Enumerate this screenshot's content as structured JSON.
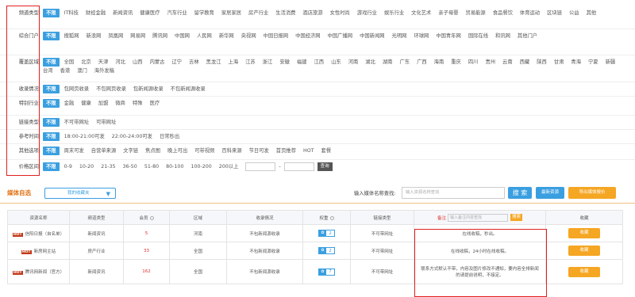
{
  "filters": [
    {
      "label": "频道类型:",
      "unlimited": "不限",
      "options": [
        "IT科技",
        "财经金融",
        "新闻资讯",
        "健康医疗",
        "汽车行业",
        "留学教育",
        "家居家居",
        "房产行业",
        "生活消费",
        "酒店旅游",
        "女性时尚",
        "游戏行业",
        "娱乐行业",
        "文化艺术",
        "亲子母婴",
        "贸易能源",
        "食品餐饮",
        "体育运动",
        "区块链",
        "公益",
        "其他"
      ]
    },
    {
      "label": "综合门户:",
      "unlimited": "不限",
      "options": [
        "搜狐网",
        "新浪网",
        "凤凰网",
        "网易网",
        "腾讯网",
        "中国网",
        "人民网",
        "新华网",
        "央视网",
        "中国日报网",
        "中国经济网",
        "中国广播网",
        "中国新闻网",
        "光明网",
        "环球网",
        "中国青年网",
        "国际在线",
        "和讯网",
        "其他门户"
      ]
    },
    {
      "label": "覆盖区域:",
      "unlimited": "不限",
      "options": [
        "全国",
        "北京",
        "天津",
        "河北",
        "山西",
        "内蒙古",
        "辽宁",
        "吉林",
        "黑龙江",
        "上海",
        "江苏",
        "浙江",
        "安徽",
        "福建",
        "江西",
        "山东",
        "河南",
        "湖北",
        "湖南",
        "广东",
        "广西",
        "海南",
        "重庆",
        "四川",
        "贵州",
        "云南",
        "西藏",
        "陕西",
        "甘肃",
        "青海",
        "宁夏",
        "新疆",
        "台湾",
        "香港",
        "澳门",
        "海外发稿"
      ]
    },
    {
      "label": "收录情况:",
      "unlimited": "不限",
      "options": [
        "包网页收录",
        "不包网页收录",
        "包新闻源收录",
        "不包新闻源收录"
      ]
    },
    {
      "label": "特别行业:",
      "unlimited": "不限",
      "options": [
        "金融",
        "健康",
        "加盟",
        "微商",
        "特殊",
        "医疗"
      ]
    },
    {
      "label": "链接类型:",
      "unlimited": "不限",
      "options": [
        "不可带网址",
        "可带网址"
      ]
    },
    {
      "label": "参考时间:",
      "unlimited": "不限",
      "options": [
        "18:00-21:00可发",
        "22:00-24:00可发",
        "日常秒出"
      ]
    },
    {
      "label": "其他选项:",
      "unlimited": "不限",
      "options": [
        "周末可发",
        "自营单来源",
        "文字链",
        "焦点图",
        "晚上可出",
        "可带视频",
        "百科来源",
        "节日可发",
        "首页推荐",
        "HOT",
        "套餐"
      ]
    },
    {
      "label": "价格区间:",
      "unlimited": "不限",
      "options": [
        "0-9",
        "10-20",
        "21-35",
        "36-50",
        "51-80",
        "80-100",
        "100-200",
        "200以上"
      ],
      "dash": "-",
      "query": "查询"
    }
  ],
  "media": {
    "title": "媒体自选",
    "select": "我的收藏夹",
    "search_label": "输入媒体名称查找:",
    "search_placeholder": "输入资源名称查找",
    "search_btn": "搜 索",
    "new_btn": "最新资源",
    "export_btn": "导出媒体报价"
  },
  "table": {
    "headers": [
      "资源名称",
      "频道类型",
      "会员",
      "区域",
      "收录情况",
      "权重",
      "链接类型",
      "",
      "收藏"
    ],
    "remark_label": "备注",
    "remark_placeholder": "输入备注内容查找",
    "remark_btn": "搜索",
    "rows": [
      {
        "hot": "HOT",
        "name": "信阳日报（自名单）",
        "channel": "新闻资讯",
        "price": "5",
        "region": "河南",
        "index": "不包新闻源收录",
        "weight": "2",
        "link": "不可带网址",
        "remark": "在线收稿，秒出。",
        "fav": "收藏"
      },
      {
        "hot": "HOT",
        "name": "新房网主站",
        "channel": "房产行业",
        "price": "33",
        "region": "全国",
        "index": "不包新闻源收录",
        "weight": "2",
        "link": "不可带网址",
        "remark": "在线收稿，24小时在线收稿。",
        "fav": "收藏"
      },
      {
        "hot": "HOT",
        "name": "腾讯网新闻（官方）",
        "channel": "新闻资讯",
        "price": "162",
        "region": "全国",
        "index": "不包新闻源收录",
        "weight": "7",
        "link": "不可带网址",
        "remark": "联系方式默认不带，内容及图片修改不通知，要内容全排新闻的请提前说明，不接定。",
        "fav": "收藏"
      }
    ]
  }
}
